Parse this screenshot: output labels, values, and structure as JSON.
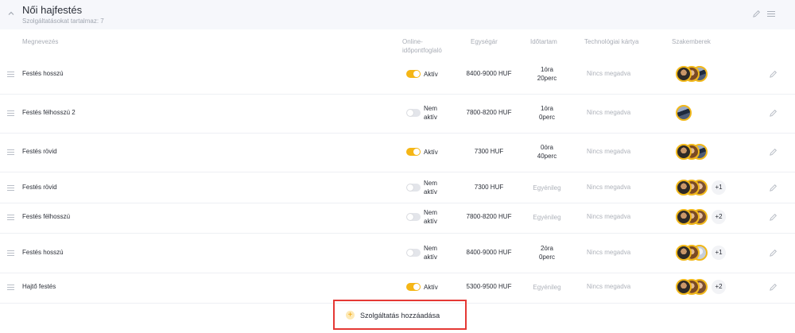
{
  "category": {
    "title": "Női hajfestés",
    "subtitle": "Szolgáltatásokat tartalmaz: 7"
  },
  "columns": {
    "name": "Megnevezés",
    "online_line1": "Online-",
    "online_line2": "időpontfoglaló",
    "price": "Egységár",
    "duration": "Időtartam",
    "tech_card": "Technológiai kártya",
    "specialists": "Szakemberek"
  },
  "services": [
    {
      "name": "Festés hosszú",
      "active": true,
      "status1": "Aktív",
      "status2": "",
      "price": "8400-9000 HUF",
      "duration1": "1óra",
      "duration2": "20perc",
      "duration_muted": false,
      "tech_card": "Nincs megadva",
      "avatars": [
        "a1",
        "a2",
        "a3"
      ],
      "extra": ""
    },
    {
      "name": "Festés félhosszú 2",
      "active": false,
      "status1": "Nem",
      "status2": "aktív",
      "price": "7800-8200 HUF",
      "duration1": "1óra",
      "duration2": "0perc",
      "duration_muted": false,
      "tech_card": "Nincs megadva",
      "avatars": [
        "a3"
      ],
      "extra": ""
    },
    {
      "name": "Festés rövid",
      "active": true,
      "status1": "Aktív",
      "status2": "",
      "price": "7300 HUF",
      "duration1": "0óra",
      "duration2": "40perc",
      "duration_muted": false,
      "tech_card": "Nincs megadva",
      "avatars": [
        "a1",
        "a2",
        "a3"
      ],
      "extra": ""
    },
    {
      "name": "Festés rövid",
      "active": false,
      "status1": "Nem",
      "status2": "aktív",
      "price": "7300 HUF",
      "duration1": "Egyénileg",
      "duration2": "",
      "duration_muted": true,
      "tech_card": "Nincs megadva",
      "avatars": [
        "a1",
        "a2",
        "a5"
      ],
      "extra": "+1"
    },
    {
      "name": "Festés félhosszú",
      "active": false,
      "status1": "Nem",
      "status2": "aktív",
      "price": "7800-8200 HUF",
      "duration1": "Egyénileg",
      "duration2": "",
      "duration_muted": true,
      "tech_card": "Nincs megadva",
      "avatars": [
        "a1",
        "a2",
        "a5"
      ],
      "extra": "+2"
    },
    {
      "name": "Festés hosszú",
      "active": false,
      "status1": "Nem",
      "status2": "aktív",
      "price": "8400-9000 HUF",
      "duration1": "2óra",
      "duration2": "0perc",
      "duration_muted": false,
      "tech_card": "Nincs megadva",
      "avatars": [
        "a1",
        "a2",
        "a4"
      ],
      "extra": "+1"
    },
    {
      "name": "Hajtő festés",
      "active": true,
      "status1": "Aktív",
      "status2": "",
      "price": "5300-9500 HUF",
      "duration1": "Egyénileg",
      "duration2": "",
      "duration_muted": true,
      "tech_card": "Nincs megadva",
      "avatars": [
        "a1",
        "a2",
        "a5"
      ],
      "extra": "+2"
    }
  ],
  "add_button": {
    "label": "Szolgáltatás hozzáadása",
    "icon": "plus-icon"
  },
  "colors": {
    "accent": "#f5b616",
    "highlight_border": "#e53935",
    "header_bg": "#f6f7fb"
  },
  "icons": {
    "collapse": "chevron-up-icon",
    "edit": "pencil-icon",
    "menu": "hamburger-icon",
    "drag": "drag-handle-icon"
  }
}
